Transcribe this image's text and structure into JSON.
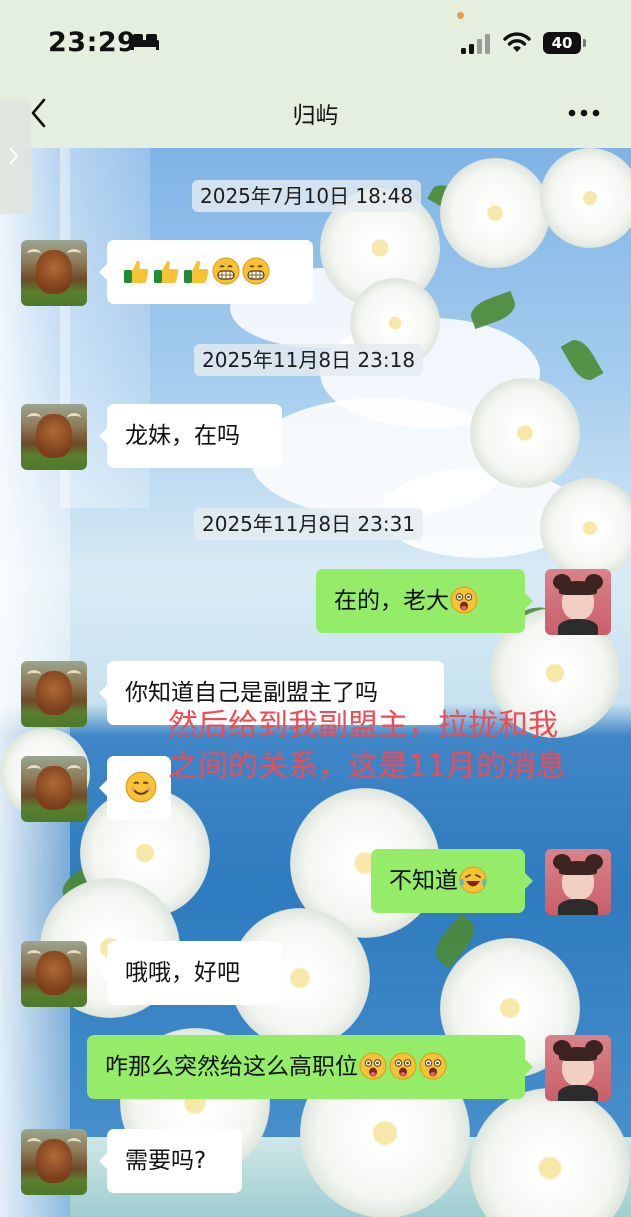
{
  "status_bar": {
    "time": "23:29",
    "battery": "40"
  },
  "nav": {
    "title": "归屿"
  },
  "timestamps": [
    "2025年7月10日 18:48",
    "2025年11月8日 23:18",
    "2025年11月8日 23:31"
  ],
  "messages": [
    {
      "from": "other",
      "text": "",
      "emojis": [
        "thumbs-up",
        "thumbs-up",
        "thumbs-up",
        "grin",
        "grin"
      ]
    },
    {
      "from": "other",
      "text": "龙妹，在吗",
      "emojis": []
    },
    {
      "from": "me",
      "text": "在的，老大",
      "emojis": [
        "astonished"
      ]
    },
    {
      "from": "other",
      "text": "你知道自己是副盟主了吗",
      "emojis": []
    },
    {
      "from": "other",
      "text": "",
      "emojis": [
        "smile"
      ]
    },
    {
      "from": "me",
      "text": "不知道",
      "emojis": [
        "laugh-cry"
      ]
    },
    {
      "from": "other",
      "text": "哦哦，好吧",
      "emojis": []
    },
    {
      "from": "me",
      "text": "咋那么突然给这么高职位",
      "emojis": [
        "astonished",
        "astonished",
        "astonished"
      ]
    },
    {
      "from": "other",
      "text": "需要吗?",
      "emojis": []
    }
  ],
  "annotation": "然后给到我副盟主，拉拢和我之间的关系，这是11月的消息",
  "colors": {
    "outgoing_bubble": "#95ec69",
    "incoming_bubble": "#ffffff",
    "annotation": "#ef4b55",
    "header_bg": "#e4efe0"
  }
}
